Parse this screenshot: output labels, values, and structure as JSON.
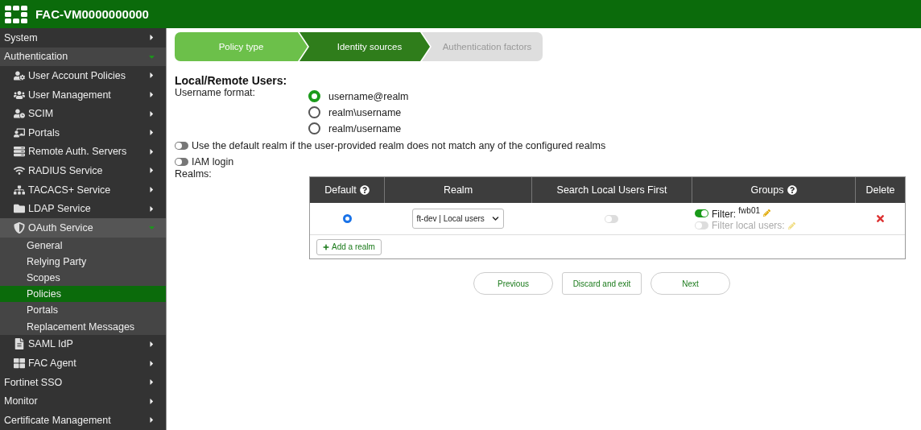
{
  "header": {
    "title": "FAC-VM0000000000"
  },
  "sidebar": {
    "items": [
      {
        "label": "System",
        "expanded": false,
        "selected": false
      },
      {
        "label": "Authentication",
        "expanded": true,
        "selected": false,
        "children": [
          {
            "label": "User Account Policies",
            "expanded": false,
            "selected": false
          },
          {
            "label": "User Management",
            "expanded": false,
            "selected": false
          },
          {
            "label": "SCIM",
            "expanded": false,
            "selected": false
          },
          {
            "label": "Portals",
            "expanded": false,
            "selected": false
          },
          {
            "label": "Remote Auth. Servers",
            "expanded": false,
            "selected": false
          },
          {
            "label": "RADIUS Service",
            "expanded": false,
            "selected": false
          },
          {
            "label": "TACACS+ Service",
            "expanded": false,
            "selected": false
          },
          {
            "label": "LDAP Service",
            "expanded": false,
            "selected": false
          },
          {
            "label": "OAuth Service",
            "expanded": true,
            "selected": false,
            "children": [
              {
                "label": "General",
                "selected": false
              },
              {
                "label": "Relying Party",
                "selected": false
              },
              {
                "label": "Scopes",
                "selected": false
              },
              {
                "label": "Policies",
                "selected": true
              },
              {
                "label": "Portals",
                "selected": false
              },
              {
                "label": "Replacement Messages",
                "selected": false
              }
            ]
          },
          {
            "label": "SAML IdP",
            "expanded": false,
            "selected": false
          },
          {
            "label": "FAC Agent",
            "expanded": false,
            "selected": false
          }
        ]
      },
      {
        "label": "Fortinet SSO",
        "expanded": false,
        "selected": false
      },
      {
        "label": "Monitor",
        "expanded": false,
        "selected": false
      },
      {
        "label": "Certificate Management",
        "expanded": false,
        "selected": false
      }
    ]
  },
  "wizard": {
    "steps": [
      {
        "label": "Policy type",
        "done": true,
        "selected": false
      },
      {
        "label": "Identity sources",
        "done": false,
        "selected": true
      },
      {
        "label": "Authentication factors",
        "done": false,
        "selected": false
      }
    ]
  },
  "section_title": "Local/Remote Users:",
  "username_format": {
    "label": "Username format:",
    "options": [
      {
        "label": "username@realm",
        "selected": true
      },
      {
        "label": "realm\\username",
        "selected": false
      },
      {
        "label": "realm/username",
        "selected": false
      }
    ]
  },
  "toggles": [
    {
      "label": "Use the default realm if the user-provided realm does not match any of the configured realms",
      "on": false
    },
    {
      "label": "IAM login",
      "on": false
    }
  ],
  "realms": {
    "label": "Realms:",
    "columns": [
      {
        "label": "Default",
        "help": true
      },
      {
        "label": "Realm",
        "help": false
      },
      {
        "label": "Search Local Users First",
        "help": false
      },
      {
        "label": "Groups",
        "help": true
      },
      {
        "label": "Delete",
        "help": false
      }
    ],
    "rows": [
      {
        "default": true,
        "realm": "ft-dev | Local users",
        "search_local_first": false,
        "filters": [
          {
            "label": "Filter: $^{fwb01}$",
            "on": true
          },
          {
            "label": "Filter local users:",
            "on": false
          }
        ]
      }
    ],
    "add_button": "Add a realm"
  },
  "buttons": [
    {
      "label": "Previous",
      "kind": "pill"
    },
    {
      "label": "Discard and exit",
      "kind": "square"
    },
    {
      "label": "Next",
      "kind": "pill"
    }
  ]
}
